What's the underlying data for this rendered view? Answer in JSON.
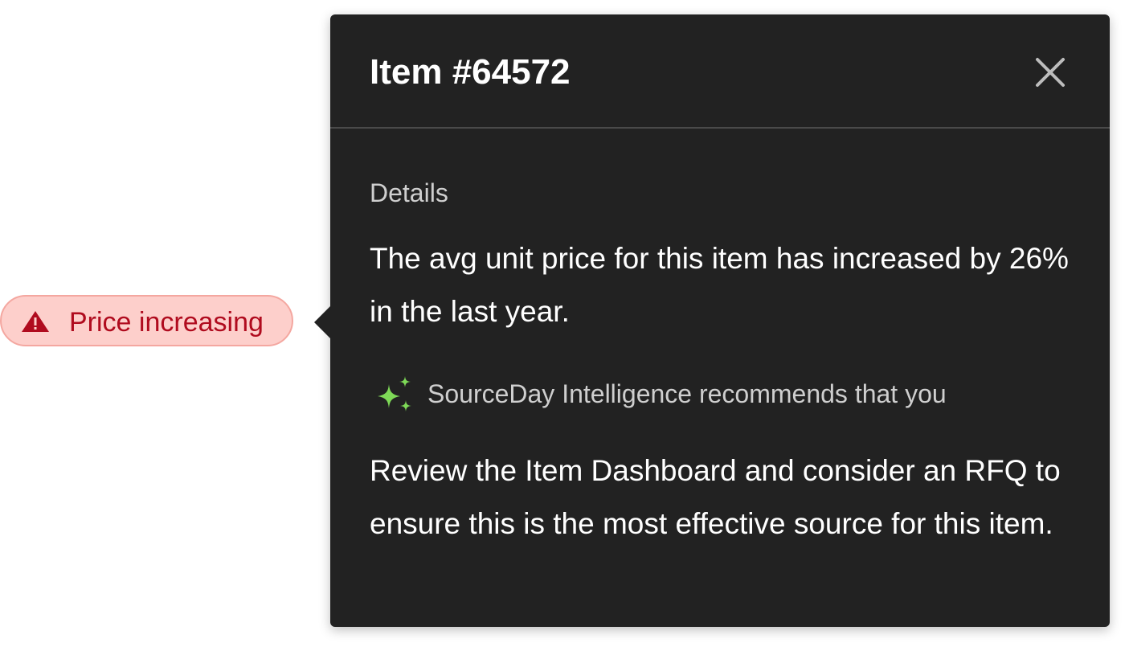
{
  "badge": {
    "icon": "warning-triangle-icon",
    "label": "Price increasing",
    "text_color": "#b00b1e",
    "background": "#fdcfcb",
    "border_color": "#f4a7a0"
  },
  "popover": {
    "title": "Item #64572",
    "close_icon": "close-icon",
    "background": "#222222",
    "details": {
      "label": "Details",
      "text": "The avg unit price for this item has increased by 26% in the last year."
    },
    "recommendation": {
      "icon": "sparkle-icon",
      "icon_color": "#7ed957",
      "label": "SourceDay Intelligence recommends that you",
      "text": "Review the Item Dashboard and consider an RFQ to ensure this is the most effective source for this item."
    }
  }
}
